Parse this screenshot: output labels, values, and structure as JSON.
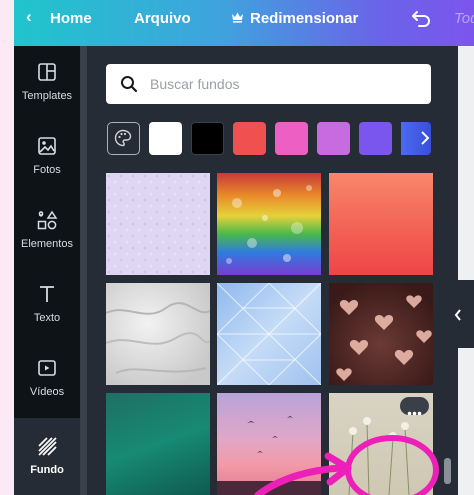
{
  "topbar": {
    "back_label": "‹",
    "home_label": "Home",
    "file_label": "Arquivo",
    "resize_label": "Redimensionar",
    "undo_icon": "undo-icon",
    "cut_label": "Tod"
  },
  "rail": {
    "items": [
      {
        "label": "Templates",
        "icon": "templates-icon"
      },
      {
        "label": "Fotos",
        "icon": "photo-icon"
      },
      {
        "label": "Elementos",
        "icon": "shapes-icon"
      },
      {
        "label": "Texto",
        "icon": "text-icon"
      },
      {
        "label": "Vídeos",
        "icon": "video-icon"
      },
      {
        "label": "Fundo",
        "icon": "background-icon"
      }
    ],
    "active": "Fundo"
  },
  "search": {
    "placeholder": "Buscar fundos"
  },
  "colors": {
    "swatches": [
      "#ffffff",
      "#000000",
      "#f15050",
      "#ee5fc4",
      "#c86be0",
      "#7a55ee"
    ],
    "accent": "#7c55ee"
  },
  "thumbnails": [
    {
      "name": "lavender-pattern"
    },
    {
      "name": "rainbow-glitter"
    },
    {
      "name": "coral-gradient"
    },
    {
      "name": "white-plaster"
    },
    {
      "name": "blue-triangles"
    },
    {
      "name": "heart-bokeh"
    },
    {
      "name": "teal-texture"
    },
    {
      "name": "pink-sky-birds"
    },
    {
      "name": "flowers-grass"
    }
  ]
}
